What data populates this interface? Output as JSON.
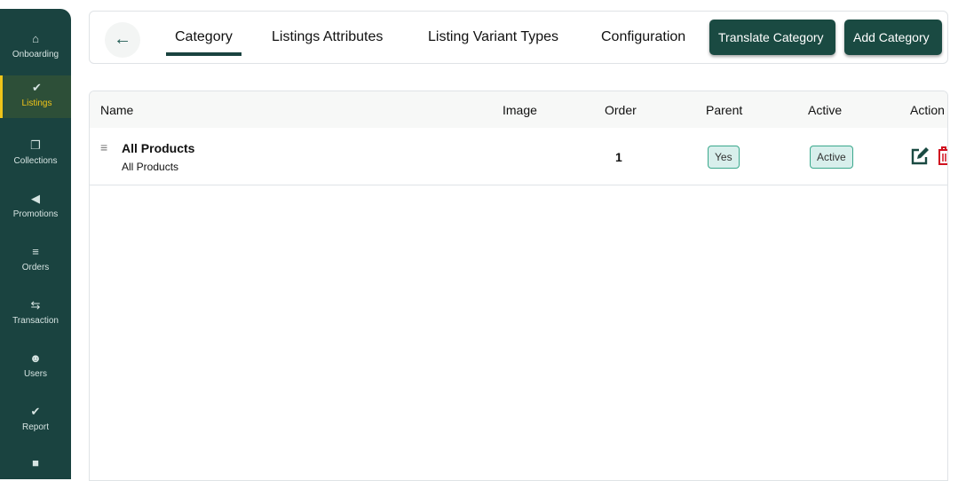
{
  "sidebar": {
    "items": [
      {
        "label": "Onboarding",
        "icon": "home-icon"
      },
      {
        "label": "Listings",
        "icon": "clipboard-check-icon",
        "active": true
      },
      {
        "label": "Collections",
        "icon": "copy-icon"
      },
      {
        "label": "Promotions",
        "icon": "megaphone-icon"
      },
      {
        "label": "Orders",
        "icon": "database-icon"
      },
      {
        "label": "Transaction",
        "icon": "exchange-icon"
      },
      {
        "label": "Users",
        "icon": "users-icon"
      },
      {
        "label": "Report",
        "icon": "clipboard-check-icon"
      },
      {
        "label": "",
        "icon": "folder-icon"
      }
    ]
  },
  "topbar": {
    "tabs": [
      "Category",
      "Listings Attributes",
      "Listing Variant Types",
      "Configuration"
    ],
    "translate": "Translate Category",
    "add": "Add Category"
  },
  "table": {
    "headers": [
      "Name",
      "Image",
      "Order",
      "Parent",
      "Active",
      "Action"
    ],
    "rows": [
      {
        "name": "All Products",
        "subtitle": "All Products",
        "order": "1",
        "parent": "Yes",
        "active": "Active"
      }
    ]
  },
  "colors": {
    "sidebar": "#1a4340",
    "accent": "#f0c419",
    "badge": "#d8efec",
    "delete": "#d0101f"
  }
}
